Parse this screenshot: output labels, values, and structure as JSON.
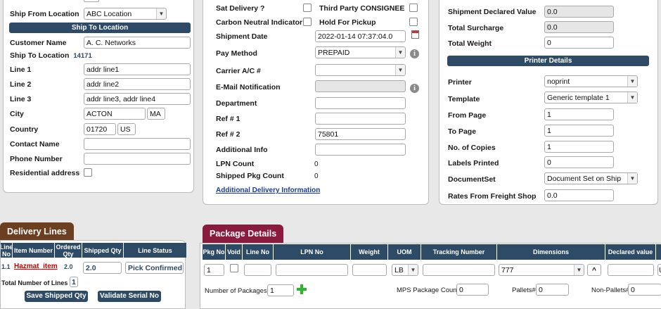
{
  "ship_panel": {
    "ship_from_location_label": "Ship From Location",
    "ship_from_location_value": "ABC Location",
    "ship_to_location_header": "Ship To Location",
    "customer_name_label": "Customer Name",
    "customer_name_value": "A. C. Networks",
    "ship_to_location_label": "Ship To Location",
    "ship_to_location_id": "14171",
    "line1_label": "Line 1",
    "line1_value": "addr line1",
    "line2_label": "Line 2",
    "line2_value": "addr line2",
    "line3_label": "Line 3",
    "line3_value": "addr line3, addr line4",
    "city_label": "City",
    "city_value": "ACTON",
    "state_value": "MA",
    "country_label": "Country",
    "zip_value": "01720",
    "country_value": "US",
    "contact_name_label": "Contact Name",
    "phone_number_label": "Phone Number",
    "residential_address_label": "Residential address"
  },
  "delivery_panel": {
    "sat_delivery_label": "Sat Delivery ?",
    "third_party_label": "Third Party CONSIGNEE",
    "carbon_neutral_label": "Carbon Neutral Indicator",
    "hold_for_pickup_label": "Hold For Pickup",
    "shipment_date_label": "Shipment Date",
    "shipment_date_value": "2022-01-14 07:37:04.0",
    "pay_method_label": "Pay Method",
    "pay_method_value": "PREPAID",
    "carrier_ac_label": "Carrier A/C #",
    "email_notification_label": "E-Mail Notification",
    "department_label": "Department",
    "ref1_label": "Ref # 1",
    "ref2_label": "Ref # 2",
    "ref2_value": "75801",
    "additional_info_label": "Additional Info",
    "lpn_count_label": "LPN Count",
    "lpn_count_value": "0",
    "shipped_pkg_count_label": "Shipped Pkg Count",
    "shipped_pkg_count_value": "0",
    "additional_delivery_link": "Additional Delivery Information"
  },
  "summary_panel": {
    "declared_value_label": "Shipment Declared Value",
    "declared_value_value": "0.0",
    "total_surcharge_label": "Total Surcharge",
    "total_surcharge_value": "0.0",
    "total_weight_label": "Total Weight",
    "total_weight_value": "0",
    "printer_details_header": "Printer Details",
    "printer_label": "Printer",
    "printer_value": "noprint",
    "template_label": "Template",
    "template_value": "Generic template 1",
    "from_page_label": "From Page",
    "from_page_value": "1",
    "to_page_label": "To Page",
    "to_page_value": "1",
    "copies_label": "No. of Copies",
    "copies_value": "1",
    "labels_printed_label": "Labels Printed",
    "labels_printed_value": "0",
    "documentset_label": "DocumentSet",
    "documentset_value": "Document Set on Ship",
    "rates_label": "Rates From Freight Shop",
    "rates_value": "0.0"
  },
  "delivery_lines": {
    "tab_label": "Delivery Lines",
    "columns": [
      "Line No",
      "Item Number",
      "Ordered Qty",
      "Shipped Qty",
      "Line Status"
    ],
    "row": {
      "line_no": "1.1",
      "item_number": "Hazmat_item",
      "ordered_qty": "2.0",
      "shipped_qty": "2.0",
      "line_status": "Pick Confirmed"
    },
    "total_lines_label": "Total Number of Lines :",
    "total_lines_value": "1",
    "save_button": "Save Shipped Qty",
    "validate_button": "Validate Serial No"
  },
  "package_details": {
    "tab_label": "Package Details",
    "columns": [
      "Pkg No",
      "Void",
      "Line No",
      "LPN No",
      "Weight",
      "UOM",
      "Tracking Number",
      "Dimensions",
      "Declared value"
    ],
    "row": {
      "pkg_no": "1",
      "uom": "LB",
      "dimensions": "777",
      "expand_glyph": "^",
      "last_cell": "U"
    },
    "num_packages_label": "Number of Packages",
    "num_packages_value": "1",
    "mps_count_label": "MPS Package Count",
    "mps_count_value": "0",
    "pallets_label": "Pallets#",
    "pallets_value": "0",
    "non_pallets_label": "Non-Pallets#",
    "non_pallets_value": "0"
  },
  "colors": {
    "header_bar": "#2d4a66",
    "delivery_tab": "#6b3f1f",
    "package_tab": "#8b1a3f",
    "link": "#1a3d9a",
    "hazmat_link": "#cc0000",
    "add_icon": "#2db52d"
  }
}
